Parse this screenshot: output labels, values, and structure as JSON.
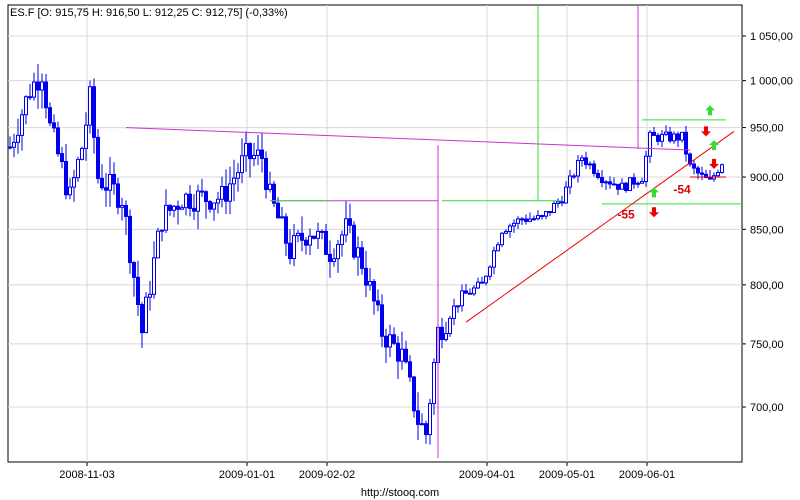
{
  "chart_data": {
    "type": "candlestick",
    "title": "ES.F [O: 915,75  H: 916,50  L: 912,25  C: 912,75] (-0,33%)",
    "footer": "http://stooq.com",
    "y_scale": "log",
    "ylim": [
      655,
      1085
    ],
    "y_ticks": [
      {
        "value": 1050,
        "label": "1 050,00"
      },
      {
        "value": 1000,
        "label": "1 000,00"
      },
      {
        "value": 950,
        "label": "950,00"
      },
      {
        "value": 900,
        "label": "900,00"
      },
      {
        "value": 850,
        "label": "850,00"
      },
      {
        "value": 800,
        "label": "800,00"
      },
      {
        "value": 750,
        "label": "750,00"
      },
      {
        "value": 700,
        "label": "700,00"
      }
    ],
    "x_ticks": [
      {
        "index": 20,
        "label": "2008-11-03"
      },
      {
        "index": 60,
        "label": "2009-01-01"
      },
      {
        "index": 80,
        "label": "2009-02-02"
      },
      {
        "index": 120,
        "label": "2009-04-01"
      },
      {
        "index": 140,
        "label": "2009-05-01"
      },
      {
        "index": 160,
        "label": "2009-06-01"
      }
    ],
    "bar_count": 180,
    "close_anchors": [
      [
        0,
        930
      ],
      [
        5,
        990
      ],
      [
        8,
        1010
      ],
      [
        10,
        950
      ],
      [
        15,
        880
      ],
      [
        18,
        930
      ],
      [
        20,
        980
      ],
      [
        22,
        900
      ],
      [
        28,
        880
      ],
      [
        33,
        760
      ],
      [
        38,
        860
      ],
      [
        43,
        880
      ],
      [
        48,
        880
      ],
      [
        53,
        880
      ],
      [
        59,
        920
      ],
      [
        63,
        920
      ],
      [
        65,
        880
      ],
      [
        70,
        830
      ],
      [
        75,
        850
      ],
      [
        80,
        830
      ],
      [
        84,
        850
      ],
      [
        88,
        820
      ],
      [
        93,
        760
      ],
      [
        98,
        740
      ],
      [
        102,
        690
      ],
      [
        104,
        680
      ],
      [
        107,
        760
      ],
      [
        113,
        790
      ],
      [
        118,
        800
      ],
      [
        123,
        850
      ],
      [
        128,
        860
      ],
      [
        133,
        860
      ],
      [
        138,
        880
      ],
      [
        143,
        920
      ],
      [
        148,
        900
      ],
      [
        153,
        890
      ],
      [
        158,
        900
      ],
      [
        160,
        940
      ],
      [
        168,
        940
      ],
      [
        170,
        910
      ],
      [
        173,
        900
      ],
      [
        175,
        895
      ],
      [
        178,
        915
      ]
    ],
    "colors": {
      "candle": "#0000ee",
      "grid": "#d8d8d8",
      "magenta": "#cc33cc",
      "green": "#33dd33",
      "red": "#ee0000"
    },
    "annotations": {
      "neckline": {
        "from": [
          29,
          950
        ],
        "to": [
          170,
          927
        ]
      },
      "magenta_h": {
        "from": [
          65,
          877
        ],
        "to": [
          107,
          877
        ],
        "price": 877
      },
      "magenta_v": [
        {
          "index": 107,
          "top": 932,
          "bottom": 662
        },
        {
          "index": 157,
          "top": 1085,
          "bottom": 928
        }
      ],
      "green_v": {
        "index": 132,
        "top": 1085,
        "bottom": 877
      },
      "green_h": [
        {
          "from": 65,
          "to": 80,
          "price": 877
        },
        {
          "from": 108,
          "to": 138,
          "price": 877
        },
        {
          "from": 148,
          "to": 183,
          "price": 874
        },
        {
          "from": 158,
          "to": 179,
          "price": 958
        }
      ],
      "red_trend": {
        "from": [
          114,
          768
        ],
        "to": [
          181,
          946
        ]
      },
      "red_h": {
        "from": 170,
        "to": 179,
        "price": 900
      },
      "labels": [
        {
          "text": "-55",
          "index": 154,
          "price": 860
        },
        {
          "text": "-54",
          "index": 168,
          "price": 884
        }
      ],
      "up_arrows": [
        [
          161,
          885
        ],
        [
          175,
          968
        ],
        [
          176,
          932
        ]
      ],
      "down_arrows": [
        [
          161,
          866
        ],
        [
          174,
          946
        ],
        [
          176,
          913
        ]
      ]
    }
  }
}
